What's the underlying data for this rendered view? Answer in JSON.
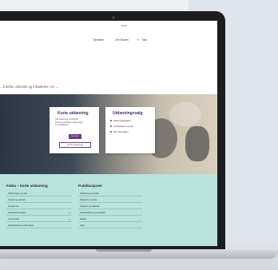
{
  "header": {
    "top_link": "Hjem",
    "nav": [
      "Tjenester",
      "Om Skolen",
      "Søk"
    ]
  },
  "intro": {
    "text": "...å delta i arbeidet og inkluderes i en ...",
    "button_label": "Les mer"
  },
  "cards": {
    "middle": {
      "title": "Korte utdanning",
      "text_lines": [
        "Vår utdanning inneholder",
        "korte og praktiske utdanninger",
        "for arbeidslivet"
      ],
      "button_label": "Les mer",
      "outline_button_label": "Se alle utdanninger"
    },
    "right": {
      "title": "Utdanningsvalg",
      "items": [
        "Utdanningskatalog",
        "Studieplasser og valg",
        "Mer informasjon"
      ]
    }
  },
  "lower": {
    "left_title": "Fakta – korte utdanning",
    "right_title": "Publikasjoner",
    "left_links": [
      "Utdanninger og yrker",
      "Opptak og søknad",
      "Kontakt oss",
      "Studentinformasjon",
      "Læringsmål",
      "Søknadsfrist og informasjon"
    ],
    "right_links": [
      "Veiledning og studier",
      "Rapporter og data",
      "Analyser og statistikk",
      "Undersøkelser og resultater",
      "Notater",
      "Arkiv"
    ],
    "right_link_icon": "chevron-right-icon"
  },
  "colors": {
    "brand_purple": "#6a3c86",
    "teal_background": "#b9e3dd"
  }
}
